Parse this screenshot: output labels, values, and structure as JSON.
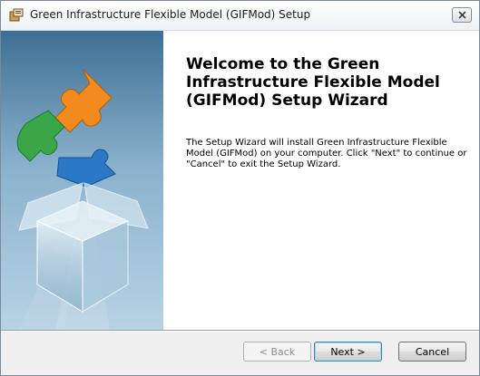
{
  "window": {
    "title": "Green Infrastructure Flexible Model (GIFMod) Setup"
  },
  "icons": {
    "app": "installer-icon",
    "close": "close-icon",
    "hero": "puzzle-box-graphic"
  },
  "welcome": {
    "heading": "Welcome to the Green Infrastructure Flexible Model (GIFMod) Setup Wizard",
    "description": "The Setup Wizard will install Green Infrastructure Flexible Model (GIFMod) on your computer.  Click \"Next\" to continue or \"Cancel\" to exit the Setup Wizard."
  },
  "buttons": {
    "back": "< Back",
    "next": "Next >",
    "cancel": "Cancel"
  },
  "colors": {
    "puzzle_orange": "#f28a1e",
    "puzzle_green": "#3aa648",
    "puzzle_blue": "#2a78c6",
    "panel_dark": "#3e6f94",
    "panel_light": "#b8d3e4"
  }
}
